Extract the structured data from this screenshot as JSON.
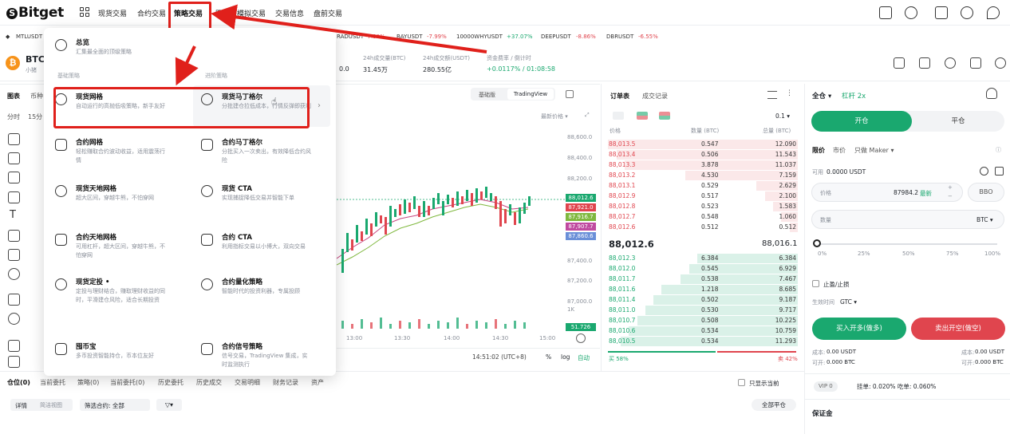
{
  "brand": {
    "name": "Bitget"
  },
  "nav": {
    "items": [
      "现货交易",
      "合约交易",
      "策略交易",
      "跟单",
      "模拟交易",
      "交易信息",
      "盘前交易"
    ],
    "active": "策略交易"
  },
  "ticker": [
    {
      "symbol": "MTLUSDT",
      "change": ""
    },
    {
      "symbol": "RADUSDT",
      "change": "-7.99%"
    },
    {
      "symbol": "BAYUSDT",
      "change": "-7.99%"
    },
    {
      "symbol": "10000WHYUSDT",
      "change": "+37.07%"
    },
    {
      "symbol": "DEEPUSDT",
      "change": "-8.86%"
    },
    {
      "symbol": "DBRUSDT",
      "change": "-6.55%"
    }
  ],
  "pair_info": {
    "symbol": "BTC",
    "sub": "小猪",
    "stats": [
      {
        "label": "24h成交量(BTC)",
        "value": "31.45万"
      },
      {
        "label": "24h成交额(USDT)",
        "value": "280.55亿"
      },
      {
        "label": "资金费率 / 倒计时",
        "value": "+0.0117% / 01:08:58"
      }
    ],
    "partial_value": "0.0"
  },
  "dropdown": {
    "overview": {
      "title": "总览",
      "desc": "汇集最全面的顶级策略"
    },
    "section_basic": "基础策略",
    "section_advanced": "进阶策略",
    "left": [
      {
        "title": "现货网格",
        "desc": "自动运行的高抛低吸策略，新手友好",
        "icon": "spot-grid-icon"
      },
      {
        "title": "合约网格",
        "desc": "轻松赚取合约波动收益，适用震荡行情",
        "icon": "futures-grid-icon"
      },
      {
        "title": "现货天地网格",
        "desc": "超大区间，穿越牛熊，不怕穿网",
        "icon": "spot-infinity-grid-icon"
      },
      {
        "title": "合约天地网格",
        "desc": "可用杠杆，超大区间，穿越牛熊，不怕穿网",
        "icon": "futures-infinity-grid-icon"
      },
      {
        "title": "现货定投 •",
        "desc": "定投与理财结合，赚取理财收益的同时，平滑建仓风险，适合长期投资",
        "icon": "spot-dca-icon"
      },
      {
        "title": "囤币宝",
        "desc": "多币投资智能持仓，币本位友好",
        "icon": "coin-vault-icon"
      }
    ],
    "right": [
      {
        "title": "现货马丁格尔",
        "desc": "分批建仓拉低成本，行情反弹即获利",
        "icon": "spot-martingale-icon"
      },
      {
        "title": "合约马丁格尔",
        "desc": "分批买入一次卖出，有效降低合约风险",
        "icon": "futures-martingale-icon"
      },
      {
        "title": "现货 CTA",
        "desc": "实现捕捉降低交易并智能下单",
        "icon": "spot-cta-icon"
      },
      {
        "title": "合约 CTA",
        "desc": "利用指标交易以小博大，双向交易",
        "icon": "futures-cta-icon"
      },
      {
        "title": "合约量化策略",
        "desc": "智能时代的投资利器，专属投顾",
        "icon": "futures-quant-icon"
      },
      {
        "title": "合约信号策略",
        "desc": "信号交易，TradingView 集成，实时监测执行",
        "icon": "futures-signal-icon"
      }
    ]
  },
  "chart": {
    "tabs": [
      "基础版",
      "TradingView"
    ],
    "tab_left": [
      "图表",
      "币种"
    ],
    "timeframes": [
      "分时",
      "15分"
    ],
    "price_type": "最新价格 ▾",
    "y_ticks": [
      "88,600.0",
      "88,400.0",
      "88,200.0",
      "87,400.0",
      "87,200.0",
      "87,000.0"
    ],
    "price_tags": [
      {
        "text": "88,012.6",
        "color": "#1aa86f"
      },
      {
        "text": "87,921.0",
        "color": "#e0454e"
      },
      {
        "text": "87,916.7",
        "color": "#7fb83e"
      },
      {
        "text": "87,907.7",
        "color": "#c04aa0"
      },
      {
        "text": "87,860.6",
        "color": "#6a8fd8"
      }
    ],
    "volume_tick": "1K",
    "volume_tag": "51.726",
    "x_ticks": [
      "13:00",
      "13:30",
      "14:00",
      "14:30",
      "15:00"
    ],
    "clock": "14:51:02 (UTC+8)",
    "footer_opts": [
      "%",
      "log",
      "自动"
    ]
  },
  "orderbook": {
    "tabs": [
      "订单表",
      "成交记录"
    ],
    "precision": "0.1 ▾",
    "headers": [
      "价格",
      "数量 (BTC)",
      "总量 (BTC)"
    ],
    "asks": [
      [
        "88,013.5",
        "0.547",
        "12.090"
      ],
      [
        "88,013.4",
        "0.506",
        "11.543"
      ],
      [
        "88,013.3",
        "3.878",
        "11.037"
      ],
      [
        "88,013.2",
        "4.530",
        "7.159"
      ],
      [
        "88,013.1",
        "0.529",
        "2.629"
      ],
      [
        "88,012.9",
        "0.517",
        "2.100"
      ],
      [
        "88,012.8",
        "0.523",
        "1.583"
      ],
      [
        "88,012.7",
        "0.548",
        "1.060"
      ],
      [
        "88,012.6",
        "0.512",
        "0.512"
      ]
    ],
    "mid_price": "88,012.6",
    "mid_mark": "88,016.1",
    "bids": [
      [
        "88,012.3",
        "6.384",
        "6.384"
      ],
      [
        "88,012.0",
        "0.545",
        "6.929"
      ],
      [
        "88,011.7",
        "0.538",
        "7.467"
      ],
      [
        "88,011.6",
        "1.218",
        "8.685"
      ],
      [
        "88,011.4",
        "0.502",
        "9.187"
      ],
      [
        "88,011.0",
        "0.530",
        "9.717"
      ],
      [
        "88,010.7",
        "0.508",
        "10.225"
      ],
      [
        "88,010.6",
        "0.534",
        "10.759"
      ],
      [
        "88,010.5",
        "0.534",
        "11.293"
      ]
    ],
    "ratio_buy": "买 58%",
    "ratio_sell": "卖 42%"
  },
  "trade": {
    "mode": "全仓 ▾",
    "leverage": "杠杆 2x",
    "open": "开仓",
    "close": "平仓",
    "order_types": [
      "限价",
      "市价",
      "只做 Maker ▾"
    ],
    "available_label": "可用",
    "available": "0.0000 USDT",
    "price_label": "价格",
    "price_value": "87984.2",
    "price_latest": "最新",
    "bbo": "BBO",
    "qty_label": "数量",
    "qty_unit": "BTC ▾",
    "slider_marks": [
      "0%",
      "25%",
      "50%",
      "75%",
      "100%"
    ],
    "tpsl": "止盈/止损",
    "tif_label": "生效时间",
    "tif": "GTC ▾",
    "buy_btn": "买入开多(做多)",
    "sell_btn": "卖出开空(做空)",
    "cost_l_label": "成本:",
    "cost_l": "0.00 USDT",
    "cost_r_label": "成本:",
    "cost_r": "0.00 USDT",
    "can_l_label": "可开:",
    "can_l": "0.000 BTC",
    "can_r_label": "可开:",
    "can_r": "0.000 BTC",
    "vip": "VIP 0",
    "fee": "挂单: 0.020%  吃单: 0.060%",
    "margin": "保证金"
  },
  "positions": {
    "tabs": [
      "仓位(0)",
      "当前委托",
      "策略(0)",
      "当前委托(0)",
      "历史委托",
      "历史成交",
      "交易明细",
      "财务记录",
      "资产"
    ],
    "only_current": "只显示当前",
    "detail_tabs": [
      "详情",
      "简洁视图"
    ],
    "filter": "筛选合约: 全部",
    "close_all": "全部平仓"
  },
  "colors": {
    "accent": "#1aa86f",
    "sell": "#e0454e",
    "highlight": "#e0201b"
  }
}
